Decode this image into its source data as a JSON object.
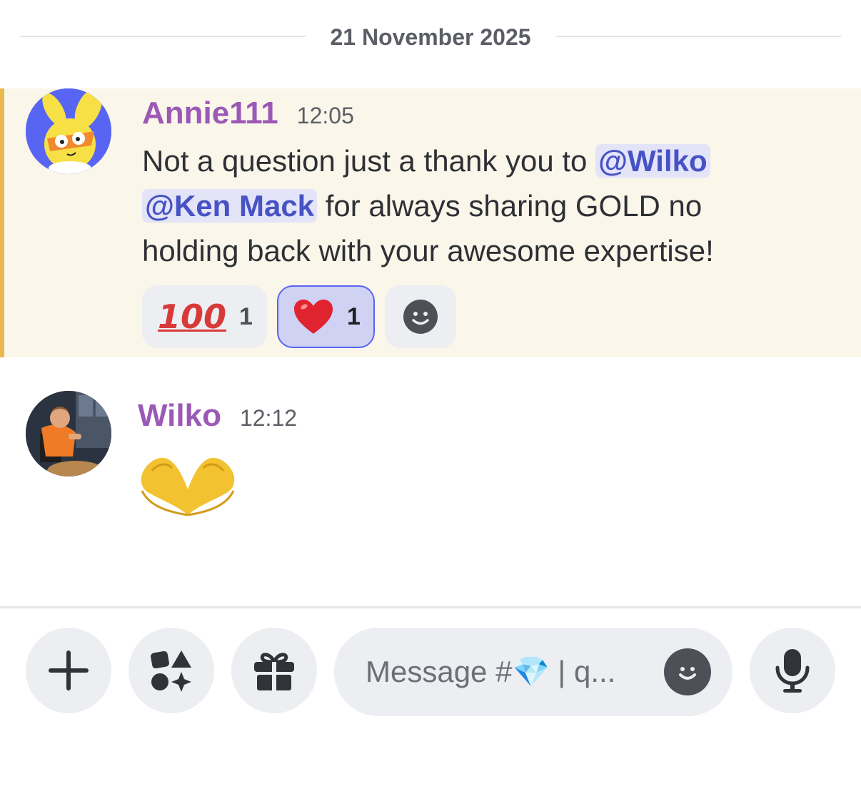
{
  "date_divider": {
    "label": "21 November 2025"
  },
  "messages": [
    {
      "username": "Annie111",
      "timestamp": "12:05",
      "text_before": "Not a question just a thank you to ",
      "mention_1": "@Wilko",
      "mention_2": "@Ken Mack",
      "text_after": " for always sharing GOLD no holding back with your awesome expertise!",
      "reactions": [
        {
          "emoji": "100",
          "count": "1",
          "active": false
        },
        {
          "emoji": "heart",
          "count": "1",
          "active": true
        }
      ],
      "highlighted": true,
      "highlight_color": "#e9b84e"
    },
    {
      "username": "Wilko",
      "timestamp": "12:12",
      "content_emoji": "heart-hands"
    }
  ],
  "composer": {
    "placeholder": "Message #💎 | q...",
    "buttons": [
      "plus-icon",
      "apps-icon",
      "gift-icon",
      "emoji-icon",
      "microphone-icon"
    ]
  },
  "colors": {
    "username": "#9b59b6",
    "mention_bg": "#e3e4f8",
    "mention_text": "#4752c4",
    "highlight_bg": "#faf6ea"
  }
}
